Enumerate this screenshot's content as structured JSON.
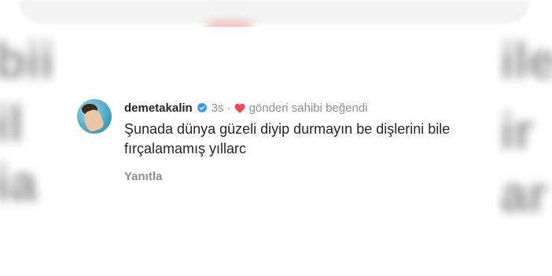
{
  "comment": {
    "username": "demetakalin",
    "verified_icon": "verified-badge-icon",
    "time": "3s",
    "separator": "·",
    "heart_icon": "heart-icon",
    "liked_label": "gönderi sahibi beğendi",
    "text": "Şunada dünya güzeli diyip durmayın be dişlerini bile fırçalamamış yıllarc",
    "reply_label": "Yanıtla"
  },
  "colors": {
    "verified": "#3897f0",
    "heart": "#ed4956",
    "text_primary": "#262626",
    "text_secondary": "#8e8e8e"
  }
}
